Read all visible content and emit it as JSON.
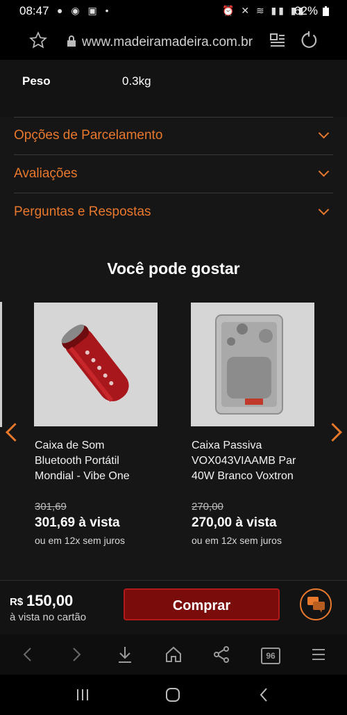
{
  "status_bar": {
    "time": "08:47",
    "battery": "62%",
    "icons": [
      "media-icon",
      "cast-icon",
      "notification-icon",
      "alarm-icon",
      "mute-icon",
      "wifi-icon",
      "signal-icon",
      "battery-icon"
    ]
  },
  "browser": {
    "url": "www.madeiramadeira.com.br"
  },
  "specs": {
    "label": "Peso",
    "value": "0.3kg"
  },
  "accordions": [
    {
      "label": "Opções de Parcelamento"
    },
    {
      "label": "Avaliações"
    },
    {
      "label": "Perguntas e Respostas"
    }
  ],
  "recommendations": {
    "title": "Você pode gostar",
    "products": [
      {
        "name_lines": [
          "Caixa de Som",
          "Bluetooth Portátil",
          "Mondial - Vibe One"
        ],
        "old_price": "301,69",
        "price": "301,69 à vista",
        "installments": "ou em 12x sem juros"
      },
      {
        "name_lines": [
          "Caixa Passiva",
          "VOX043VIAAMB Par",
          "40W Branco Voxtron"
        ],
        "old_price": "270,00",
        "price": "270,00 à vista",
        "installments": "ou em 12x sem juros"
      }
    ]
  },
  "buy_bar": {
    "currency": "R$",
    "price": "150,00",
    "note": "à vista no cartão",
    "button": "Comprar"
  },
  "browser_nav": {
    "tabs_count": "96"
  },
  "colors": {
    "accent": "#e8782c",
    "buy_button": "#7a0c0c"
  }
}
